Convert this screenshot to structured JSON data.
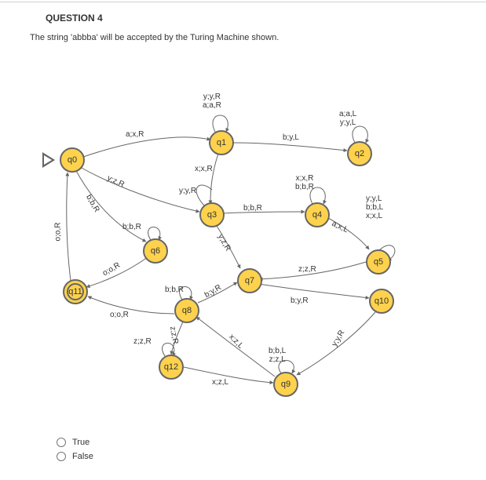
{
  "question": {
    "header": "QUESTION 4",
    "text": "The string 'abbba' will be accepted by the Turing Machine shown."
  },
  "states": {
    "q0": "q0",
    "q1": "q1",
    "q2": "q2",
    "q3": "q3",
    "q4": "q4",
    "q5": "q5",
    "q6": "q6",
    "q7": "q7",
    "q8": "q8",
    "q9": "q9",
    "q10": "q10",
    "q11": "q11",
    "q12": "q12"
  },
  "edge_labels": {
    "q1_self": "y;y,R\na;a,R",
    "q0_q1": "a;x,R",
    "q1_q2": "b;y,L",
    "q2_self": "a;a,L\ny;y,L",
    "q1_q3_xxR": "x;x,R",
    "q0_q3_yzR": "y;z,R",
    "q3_self_yyR": "y;y,R",
    "q3_q4_bbR": "b;b,R",
    "q4_self": "x;x,R\nb;b,R",
    "q4_q5_axL": "a;x,L",
    "q5_self": "y;y,L\nb;b,L\nx;x,L",
    "q0_q6_bbR": "b;b,R",
    "q6_self_bbR": "b;b,R",
    "q3_q7_yzR": "y;z,R",
    "q5_q7_zzR": "z;z,R",
    "q8_self_bbR": "b;b,R",
    "q8_q7_byR": "b;y,R",
    "q7_q10_byR": "b;y,R",
    "q10_q9_yyR": "y;y,R",
    "q9_self": "b;b,L\nz;z,L",
    "q9_q8_xzL": "x;z,L",
    "q12_q9_xzL": "x;z,L",
    "q12_self": "z;z,R",
    "q8_q12_zzR": "z;z,R",
    "q6_q11_ooR": "o;o,R",
    "q8_q11_ooR": "o;o,R",
    "q11_q0_ooR": "o;o,R"
  },
  "answers": {
    "true_label": "True",
    "false_label": "False"
  }
}
